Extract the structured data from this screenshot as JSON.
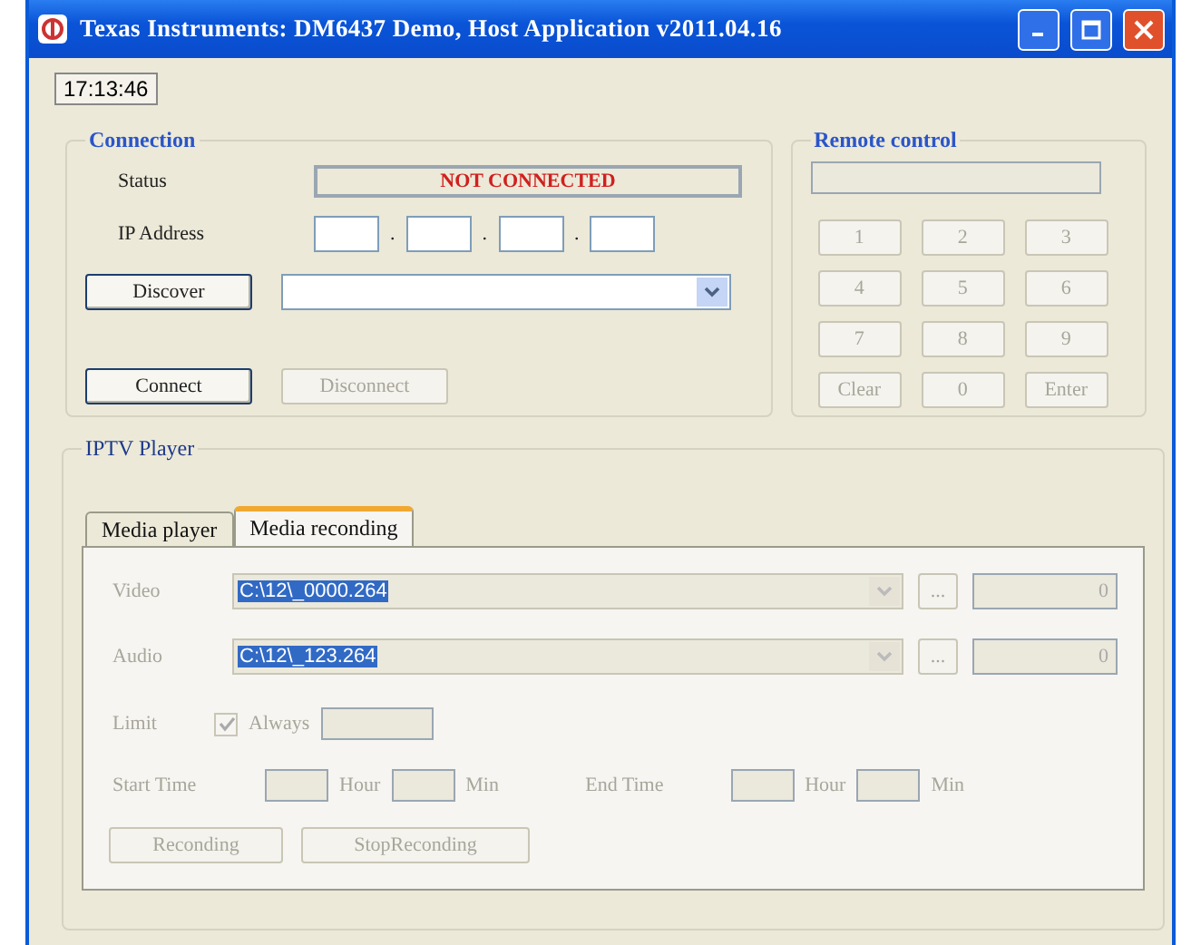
{
  "window": {
    "title": "Texas Instruments: DM6437 Demo, Host Application v2011.04.16"
  },
  "clock": "17:13:46",
  "connection": {
    "title": "Connection",
    "status_label": "Status",
    "status": "NOT CONNECTED",
    "ip_label": "IP Address",
    "ip_separators": [
      ".",
      ".",
      "."
    ],
    "discover_button": {
      "label": "Discover",
      "disabled": false
    },
    "connect_button": {
      "label": "Connect",
      "disabled": false
    },
    "disconnect_button": {
      "label": "Disconnect",
      "disabled": true
    }
  },
  "remote_control": {
    "title": "Remote control",
    "keys_disabled": true,
    "keys": [
      "1",
      "2",
      "3",
      "4",
      "5",
      "6",
      "7",
      "8",
      "9",
      "Clear",
      "0",
      "Enter"
    ]
  },
  "iptv_player": {
    "title": "IPTV  Player",
    "tabs": [
      {
        "label": "Media player",
        "selected": false
      },
      {
        "label": "Media reconding",
        "selected": true
      }
    ],
    "disabled": true,
    "files": [
      {
        "label": "Video",
        "path": "C:\\12\\_0000.264",
        "browse": "...",
        "count": "0"
      },
      {
        "label": "Audio",
        "path": "C:\\12\\_123.264",
        "browse": "...",
        "count": "0"
      }
    ],
    "limit": {
      "label": "Limit",
      "checkbox": {
        "label": "Always",
        "checked": true
      }
    },
    "start_time": {
      "label": "Start Time",
      "hour": "Hour",
      "min": "Min"
    },
    "end_time": {
      "label": "End Time",
      "hour": "Hour",
      "min": "Min"
    },
    "buttons": [
      "Reconding",
      "StopReconding"
    ]
  }
}
